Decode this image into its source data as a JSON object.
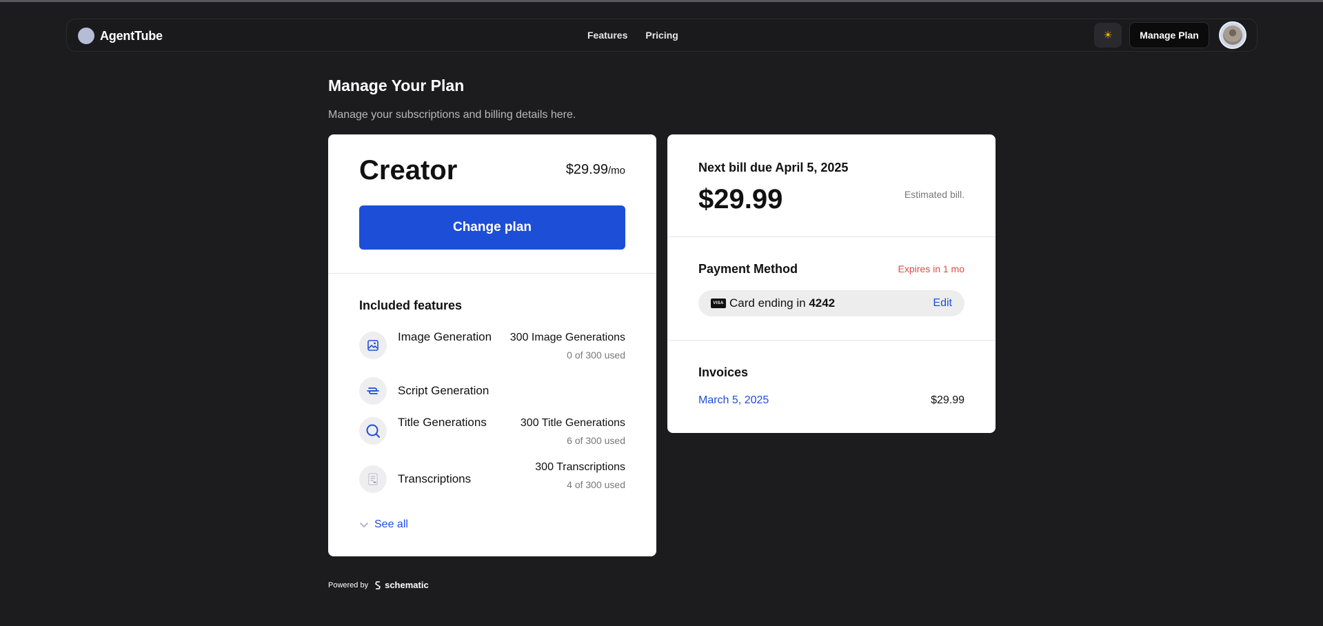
{
  "nav": {
    "brand": "AgentTube",
    "links": [
      "Features",
      "Pricing"
    ],
    "theme_icon": "☀",
    "manage_label": "Manage Plan"
  },
  "header": {
    "title": "Manage Your Plan",
    "subtitle": "Manage your subscriptions and billing details here."
  },
  "plan": {
    "name": "Creator",
    "price": "$29.99",
    "period": "/mo",
    "change_label": "Change plan",
    "features_title": "Included features",
    "features": [
      {
        "name": "Image Generation",
        "quantity": "300 Image Generations",
        "usage": "0 of 300 used",
        "icon": "image-icon"
      },
      {
        "name": "Script Generation",
        "quantity": "",
        "usage": "",
        "icon": "script-icon"
      },
      {
        "name": "Title Generations",
        "quantity": "300 Title Generations",
        "usage": "6 of 300 used",
        "icon": "search-icon"
      },
      {
        "name": "Transcriptions",
        "quantity": "300 Transcriptions",
        "usage": "4 of 300 used",
        "icon": "document-icon"
      }
    ],
    "see_all": "See all"
  },
  "billing": {
    "next_due": "Next bill due April 5, 2025",
    "amount": "$29.99",
    "estimated": "Estimated bill.",
    "payment_title": "Payment Method",
    "expires": "Expires in 1 mo",
    "card_brand": "VISA",
    "card_prefix": "Card ending in",
    "card_last4": "4242",
    "edit_label": "Edit",
    "invoices_title": "Invoices",
    "invoices": [
      {
        "date": "March 5, 2025",
        "amount": "$29.99"
      }
    ]
  },
  "footer": {
    "powered_by": "Powered by",
    "brand": "schematic"
  },
  "colors": {
    "accent": "#1d4ed8",
    "warning": "#e04848",
    "background": "#1c1c1e"
  }
}
